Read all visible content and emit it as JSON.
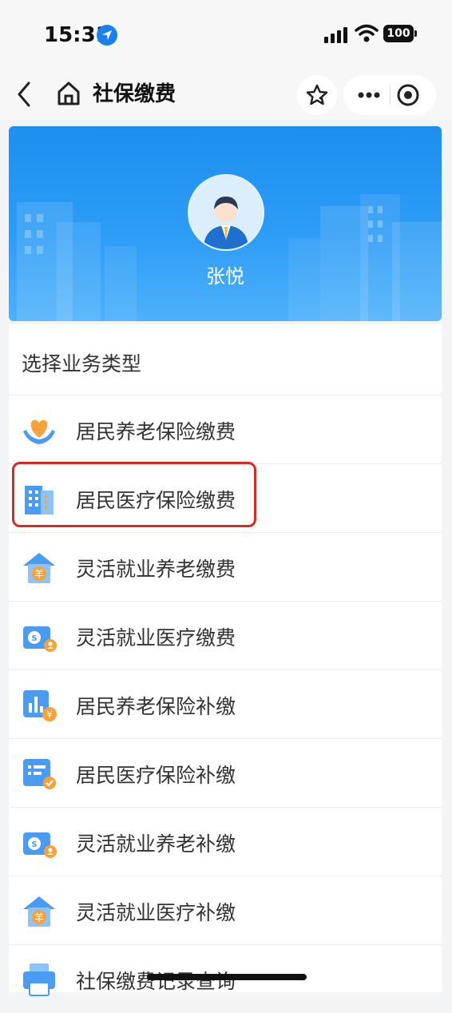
{
  "status_bar": {
    "time": "15:31",
    "battery": "100"
  },
  "nav": {
    "title": "社保缴费"
  },
  "profile": {
    "name": "张悦"
  },
  "service_panel": {
    "title": "选择业务类型",
    "items": [
      {
        "label": "居民养老保险缴费",
        "icon": "heart-hands-icon"
      },
      {
        "label": "居民医疗保险缴费",
        "icon": "hospital-building-icon"
      },
      {
        "label": "灵活就业养老缴费",
        "icon": "house-yang-icon"
      },
      {
        "label": "灵活就业医疗缴费",
        "icon": "card-person-icon"
      },
      {
        "label": "居民养老保险补缴",
        "icon": "chart-yen-icon"
      },
      {
        "label": "居民医疗保险补缴",
        "icon": "document-check-icon"
      },
      {
        "label": "灵活就业养老补缴",
        "icon": "card-person-icon"
      },
      {
        "label": "灵活就业医疗补缴",
        "icon": "house-yang-icon"
      },
      {
        "label": "社保缴费记录查询",
        "icon": "printer-icon"
      }
    ]
  },
  "colors": {
    "accent": "#1d8ff0",
    "highlight": "#e0261d",
    "icon_blue": "#4a9cf3",
    "icon_orange": "#f6a23b"
  }
}
